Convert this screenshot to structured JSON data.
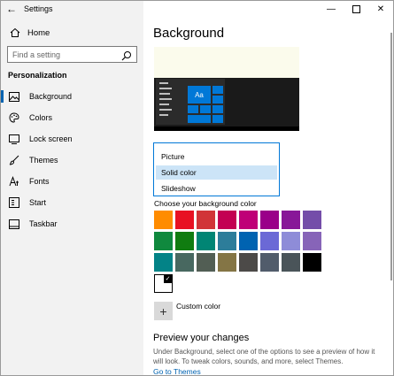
{
  "window": {
    "title": "Settings"
  },
  "sidebar": {
    "home_label": "Home",
    "search_placeholder": "Find a setting",
    "section_title": "Personalization",
    "items": [
      {
        "label": "Background",
        "icon": "image-icon",
        "active": true
      },
      {
        "label": "Colors",
        "icon": "palette-icon",
        "active": false
      },
      {
        "label": "Lock screen",
        "icon": "lock-screen-icon",
        "active": false
      },
      {
        "label": "Themes",
        "icon": "brush-icon",
        "active": false
      },
      {
        "label": "Fonts",
        "icon": "font-icon",
        "active": false
      },
      {
        "label": "Start",
        "icon": "start-icon",
        "active": false
      },
      {
        "label": "Taskbar",
        "icon": "taskbar-icon",
        "active": false
      }
    ]
  },
  "content": {
    "page_title": "Background",
    "preview_tile_label": "Aa",
    "dropdown": {
      "options": [
        "Picture",
        "Solid color",
        "Slideshow"
      ],
      "selected": "Solid color"
    },
    "choose_label": "Choose your background color",
    "colors": [
      "#ff8c00",
      "#e81123",
      "#d13438",
      "#c30052",
      "#bf0077",
      "#9a0089",
      "#881798",
      "#744da9",
      "#10893e",
      "#107c10",
      "#018574",
      "#2d7d9a",
      "#0063b1",
      "#6b69d6",
      "#8e8cd8",
      "#8764b8",
      "#038387",
      "#486860",
      "#525e54",
      "#847545",
      "#4c4a48",
      "#515c6b",
      "#4a5459",
      "#000000",
      "#ffffff"
    ],
    "selected_color": "#ffffff",
    "custom_color_label": "Custom color",
    "preview_heading": "Preview your changes",
    "preview_text": "Under Background, select one of the options to see a preview of how it will look. To tweak colors, sounds, and more, select Themes.",
    "goto_link": "Go to Themes"
  },
  "accent_color": "#0078d7"
}
